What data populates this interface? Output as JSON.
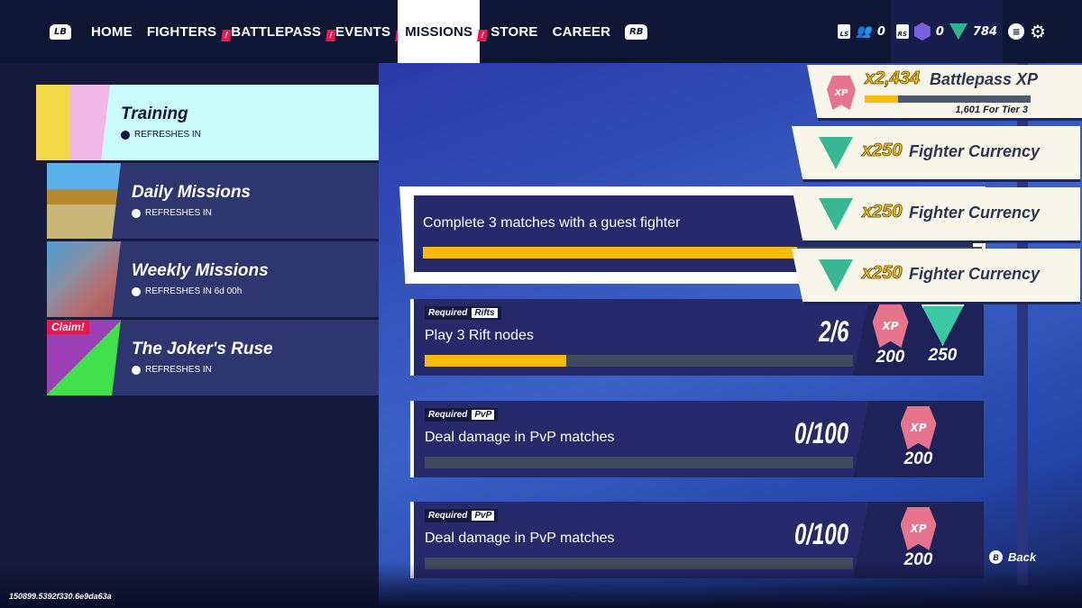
{
  "nav": {
    "lb_label": "LB",
    "rb_label": "RB",
    "items": [
      {
        "label": "HOME",
        "alert": false
      },
      {
        "label": "FIGHTERS",
        "alert": true
      },
      {
        "label": "BATTLEPASS",
        "alert": true
      },
      {
        "label": "EVENTS",
        "alert": true
      },
      {
        "label": "MISSIONS",
        "alert": true,
        "active": true
      },
      {
        "label": "STORE",
        "alert": false
      },
      {
        "label": "CAREER",
        "alert": false
      }
    ],
    "alert_glyph": "!"
  },
  "status": {
    "ls_label": "LS",
    "rs_label": "RS",
    "friends_count": "0",
    "gleamium": "0",
    "fighter_currency": "784",
    "menu_icon": "menu-icon",
    "settings_icon": "gear-icon"
  },
  "categories": [
    {
      "title": "Training",
      "refresh": "REFRESHES IN",
      "selected": true
    },
    {
      "title": "Daily Missions",
      "refresh": "REFRESHES IN"
    },
    {
      "title": "Weekly Missions",
      "refresh": "REFRESHES IN 6d 00h"
    },
    {
      "title": "The Joker's Ruse",
      "refresh": "REFRESHES IN",
      "badge": "Claim!"
    }
  ],
  "highlighted_mission": {
    "description": "Complete 3 matches with a guest fighter",
    "progress": 0.67
  },
  "missions": [
    {
      "required": "Required",
      "type": "Rifts",
      "description": "Play 3 Rift nodes",
      "count": "2/6",
      "progress": 0.33,
      "rewards": [
        {
          "kind": "xp",
          "amount": "200"
        },
        {
          "kind": "fighter-currency",
          "amount": "250"
        }
      ]
    },
    {
      "required": "Required",
      "type": "PvP",
      "description": "Deal damage in PvP matches",
      "count": "0/100",
      "progress": 0,
      "rewards": [
        {
          "kind": "xp",
          "amount": "200"
        }
      ]
    },
    {
      "required": "Required",
      "type": "PvP",
      "description": "Deal damage in PvP matches",
      "count": "0/100",
      "progress": 0,
      "rewards": [
        {
          "kind": "xp",
          "amount": "200"
        }
      ]
    }
  ],
  "toasts": [
    {
      "qty": "x2,434",
      "label": "Battlepass XP",
      "tier_text": "1,601 For Tier 3",
      "progress": 0.2
    },
    {
      "qty": "x250",
      "label": "Fighter Currency"
    },
    {
      "qty": "x250",
      "label": "Fighter Currency"
    },
    {
      "qty": "x250",
      "label": "Fighter Currency"
    }
  ],
  "xp_glyph": "XP",
  "back": {
    "button": "B",
    "label": "Back"
  },
  "build_id": "150899.5392f330.6e9da63a",
  "colors": {
    "accent_yellow": "#fdb90a",
    "alert_red": "#e8174f",
    "selected_card": "#c9fbfb"
  }
}
